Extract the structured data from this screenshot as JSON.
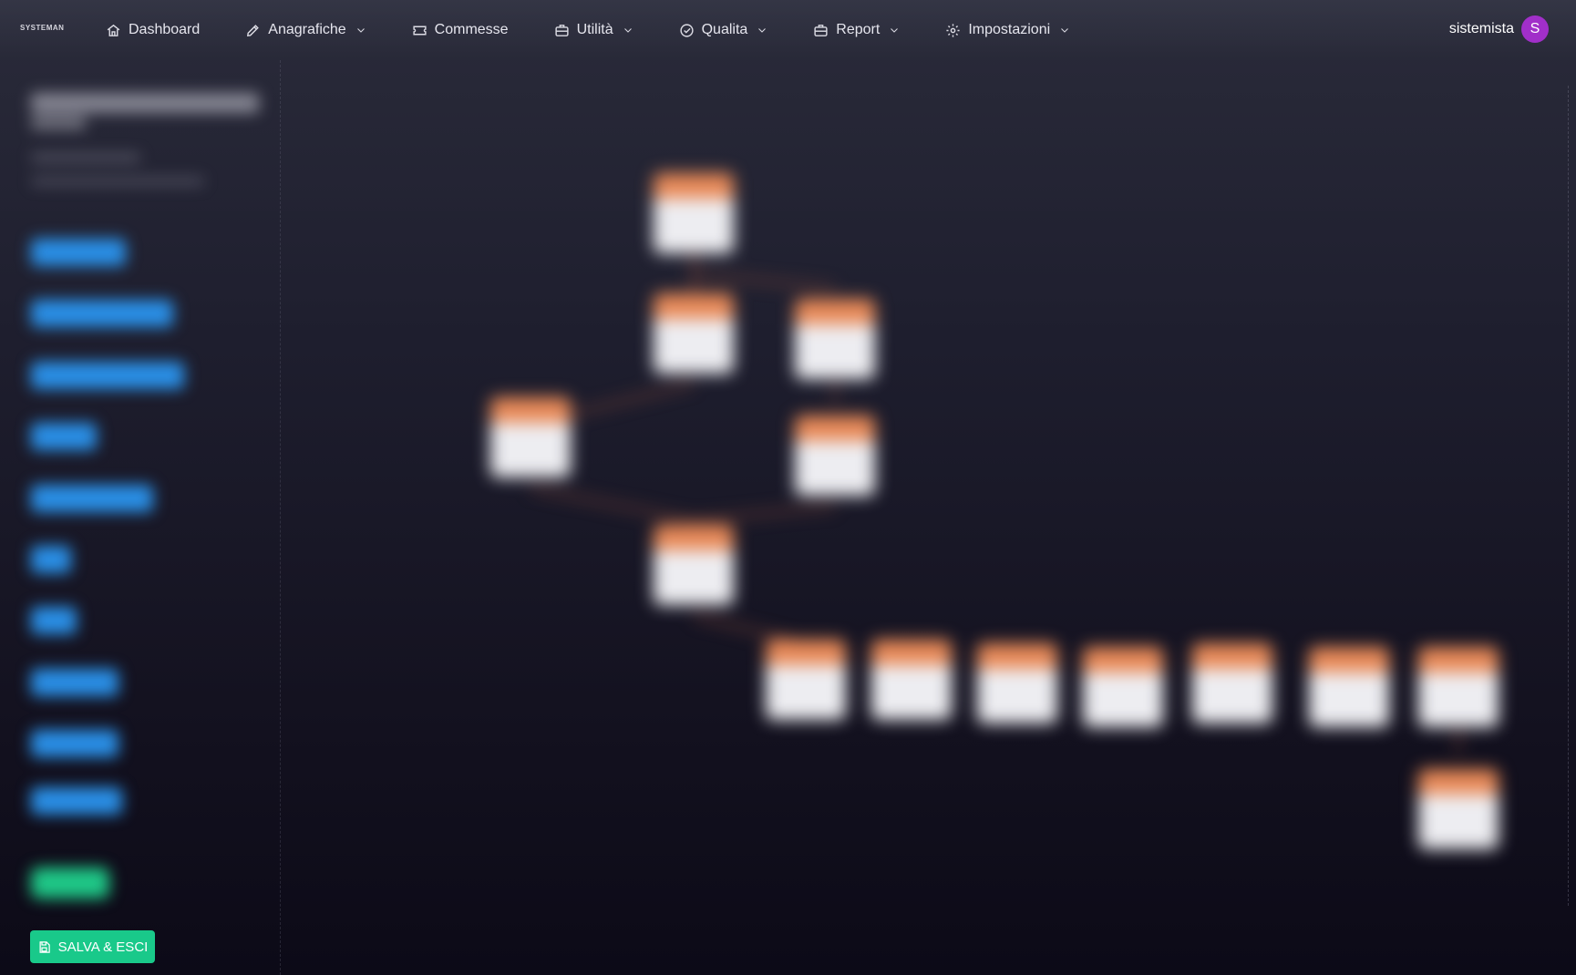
{
  "app": {
    "logo_text": "SYSTEMAN"
  },
  "nav": {
    "items": [
      {
        "label": "Dashboard",
        "icon": "home-icon",
        "has_dropdown": false
      },
      {
        "label": "Anagrafiche",
        "icon": "pencil-icon",
        "has_dropdown": true
      },
      {
        "label": "Commesse",
        "icon": "ticket-icon",
        "has_dropdown": false
      },
      {
        "label": "Utilità",
        "icon": "briefcase-icon",
        "has_dropdown": true
      },
      {
        "label": "Qualita",
        "icon": "check-circle-icon",
        "has_dropdown": true
      },
      {
        "label": "Report",
        "icon": "briefcase-icon",
        "has_dropdown": true
      },
      {
        "label": "Impostazioni",
        "icon": "gear-icon",
        "has_dropdown": true
      }
    ]
  },
  "user": {
    "name": "sistemista",
    "initial": "S",
    "avatar_color": "#a12fc9"
  },
  "footer": {
    "save_label": "SALVA & ESCI",
    "save_color": "#19c98a"
  },
  "colors": {
    "node_header": "#e98a58",
    "node_body": "#ededf1",
    "sidebar_button": "#2a8fe6",
    "sidebar_confirm": "#1fc787"
  }
}
